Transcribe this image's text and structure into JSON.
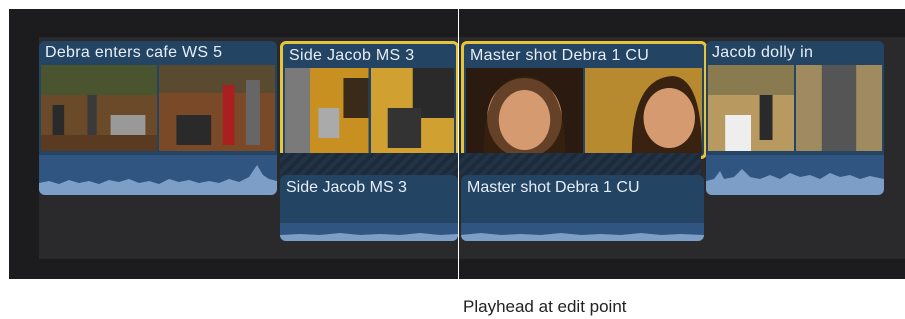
{
  "primary_clips": [
    {
      "label": "Debra enters cafe WS 5"
    },
    {
      "label": "Side Jacob MS 3"
    },
    {
      "label": "Master shot Debra 1 CU"
    },
    {
      "label": "Jacob dolly in"
    }
  ],
  "connected_clips": [
    {
      "label": "Side Jacob MS 3"
    },
    {
      "label": "Master shot Debra 1 CU"
    }
  ],
  "callout": {
    "text": "Playhead at edit point"
  },
  "colors": {
    "timeline_bg": "#1c1c1e",
    "clip_blue": "#244464",
    "waveform": "#7d9ec6",
    "selection": "#e6c53a"
  }
}
